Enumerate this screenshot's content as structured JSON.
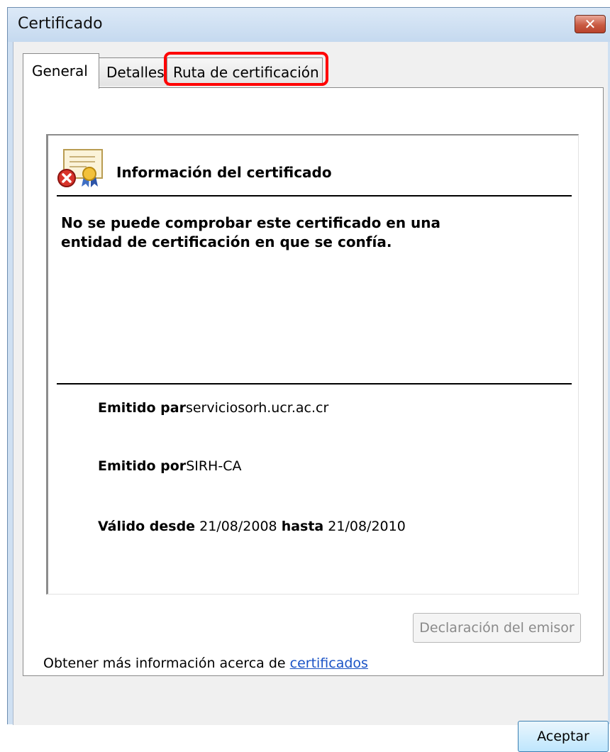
{
  "window": {
    "title": "Certificado",
    "close_glyph": "✕"
  },
  "tabs": [
    {
      "label": "General",
      "selected": true
    },
    {
      "label": "Detalles",
      "selected": false
    },
    {
      "label": "Ruta de certificación",
      "selected": false,
      "highlighted": true
    }
  ],
  "info": {
    "title": "Información del certificado",
    "warning_line1": "No se puede comprobar este certificado en una",
    "warning_line2": "entidad de certificación en que se confía.",
    "issued_to_label": "Emitido par",
    "issued_to_value": "serviciosorh.ucr.ac.cr",
    "issued_by_label": "Emitido por",
    "issued_by_value": "SIRH-CA",
    "valid_from_label": "Válido desde",
    "valid_from_value": "21/08/2008",
    "valid_to_label": "hasta",
    "valid_to_value": "21/08/2010"
  },
  "buttons": {
    "issuer_statement": "Declaración del emisor",
    "ok": "Aceptar"
  },
  "footer": {
    "more_info_text": "Obtener más información acerca de ",
    "more_info_link": "certificados"
  },
  "colors": {
    "highlight": "#ff0000",
    "link": "#1a53c6",
    "close": "#c95b43"
  },
  "icons": {
    "certificate": "certificate-error-icon"
  }
}
